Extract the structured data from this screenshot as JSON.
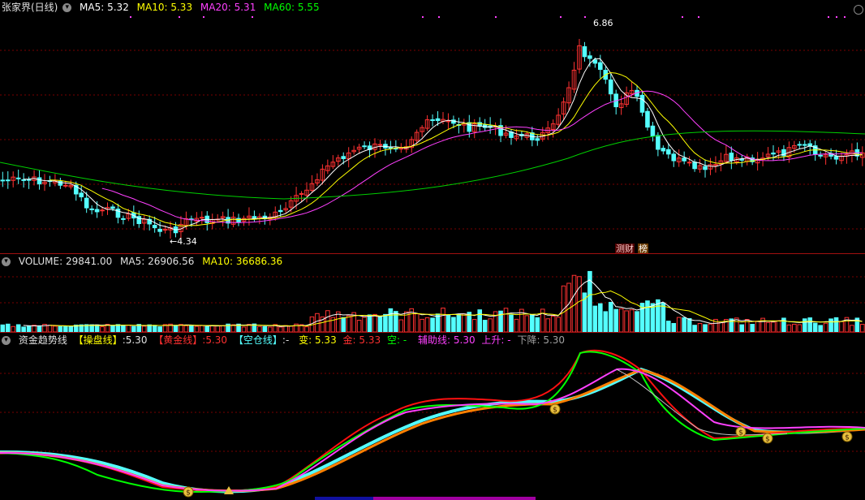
{
  "price": {
    "stock_name": "张家界(日线)",
    "ma5": {
      "label": "MA5:",
      "value": "5.32",
      "color": "#ffffff"
    },
    "ma10": {
      "label": "MA10:",
      "value": "5.33",
      "color": "#ffff00"
    },
    "ma20": {
      "label": "MA20:",
      "value": "5.31",
      "color": "#ff40ff"
    },
    "ma60": {
      "label": "MA60:",
      "value": "5.55",
      "color": "#00ff00"
    },
    "high_label": "6.86",
    "low_label": "4.34",
    "badge_left": "测财",
    "badge_right": "榜"
  },
  "volume": {
    "label": "VOLUME:",
    "value": "29841.00",
    "ma5_label": "MA5:",
    "ma5_value": "26906.56",
    "ma10_label": "MA10:",
    "ma10_value": "36686.36"
  },
  "indicator": {
    "name": "资金趋势线",
    "cao_label": "【操盘线】",
    "cao_value": ":5.30",
    "huang_label": "【黄金线】",
    "huang_value": ":5.30",
    "kong_label": "【空仓线】",
    "kong_value": ":-",
    "bian_label": "变:",
    "bian_value": "5.33",
    "jin_label": "金:",
    "jin_value": "5.33",
    "kongx_label": "空:",
    "kongx_value": "-",
    "fuzhu_label": "辅助线:",
    "fuzhu_value": "5.30",
    "up_label": "上升:",
    "up_value": "-",
    "down_label": "下降:",
    "down_value": "5.30"
  },
  "colors": {
    "up": "#ff3232",
    "down": "#54ffff",
    "ma60": "#00d000",
    "grid": "#7a0000",
    "separator": "#a01010"
  },
  "icons": {
    "collapse": "chevron-down-icon",
    "corner": "circle-icon",
    "money": "money-bag-icon"
  }
}
